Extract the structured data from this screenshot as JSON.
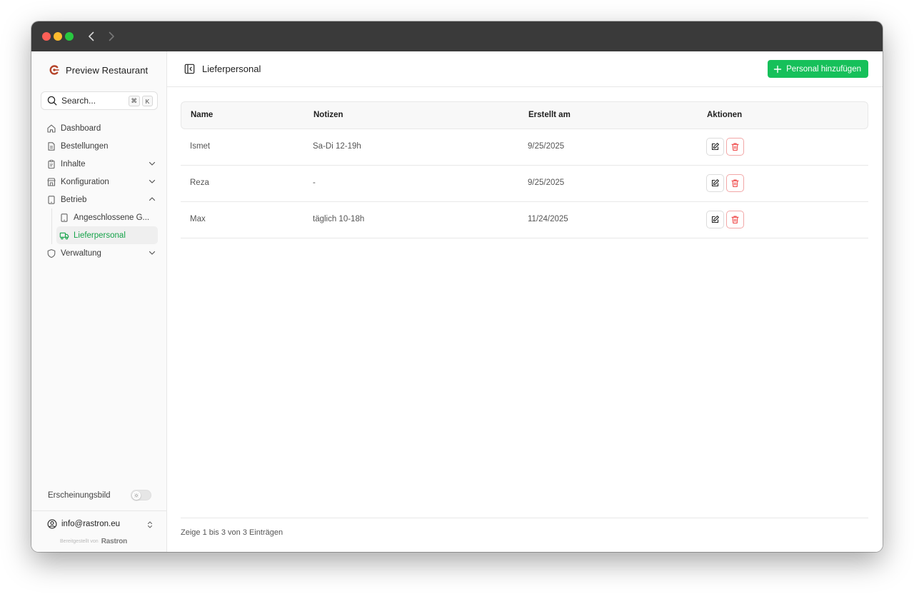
{
  "window": {
    "controls": [
      "close",
      "minimize",
      "zoom"
    ],
    "nav": {
      "back_icon": "chevron-left-icon",
      "forward_icon": "chevron-right-icon"
    }
  },
  "sidebar": {
    "brand": {
      "name": "Preview Restaurant",
      "logo_icon": "brand-logo-icon",
      "logo_color": "#b5452b"
    },
    "search": {
      "placeholder": "Search...",
      "shortcut_cmd": "⌘",
      "shortcut_key": "K"
    },
    "items": [
      {
        "label": "Dashboard",
        "icon": "home-icon"
      },
      {
        "label": "Bestellungen",
        "icon": "document-icon"
      },
      {
        "label": "Inhalte",
        "icon": "clipboard-icon",
        "expandable": true
      },
      {
        "label": "Konfiguration",
        "icon": "store-icon",
        "expandable": true
      },
      {
        "label": "Betrieb",
        "icon": "tablet-icon",
        "expandable": true,
        "expanded": true,
        "children": [
          {
            "label": "Angeschlossene G...",
            "icon": "tablet-icon"
          },
          {
            "label": "Lieferpersonal",
            "icon": "truck-icon",
            "active": true
          }
        ]
      },
      {
        "label": "Verwaltung",
        "icon": "shield-icon",
        "expandable": true
      }
    ],
    "appearance": {
      "label": "Erscheinungsbild"
    },
    "user": {
      "email": "info@rastron.eu"
    },
    "powered": {
      "text": "Bereitgestellt von",
      "brand": "Rastron"
    }
  },
  "header": {
    "title": "Lieferpersonal",
    "add_button": "Personal hinzufügen"
  },
  "table": {
    "columns": [
      "Name",
      "Notizen",
      "Erstellt am",
      "Aktionen"
    ],
    "rows": [
      {
        "name": "Ismet",
        "notes": "Sa-Di 12-19h",
        "created": "9/25/2025"
      },
      {
        "name": "Reza",
        "notes": "-",
        "created": "9/25/2025"
      },
      {
        "name": "Max",
        "notes": "täglich 10-18h",
        "created": "11/24/2025"
      }
    ],
    "footer": "Zeige 1 bis 3 von 3 Einträgen"
  },
  "colors": {
    "accent": "#16c05a",
    "active_text": "#16a34a",
    "danger": "#ef4444",
    "titlebar": "#3a3a3a"
  }
}
